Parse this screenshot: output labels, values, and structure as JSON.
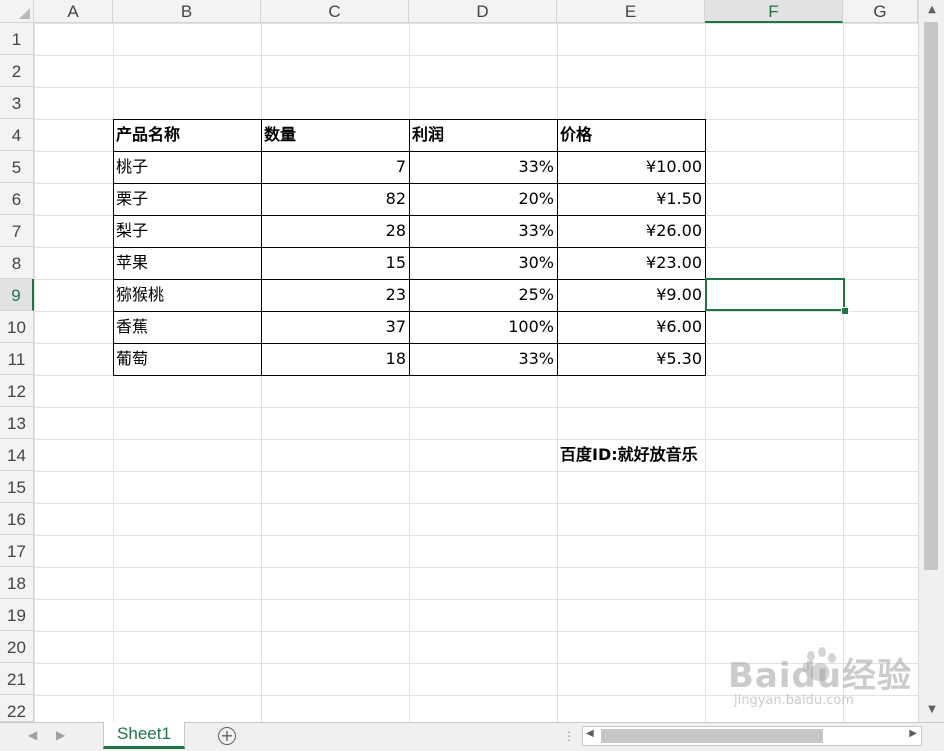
{
  "columns": [
    "A",
    "B",
    "C",
    "D",
    "E",
    "F",
    "G"
  ],
  "active_column": "F",
  "rows": [
    "1",
    "2",
    "3",
    "4",
    "5",
    "6",
    "7",
    "8",
    "9",
    "10",
    "11",
    "12",
    "13",
    "14",
    "15",
    "16",
    "17",
    "18",
    "19",
    "20",
    "21",
    "22"
  ],
  "active_row": "9",
  "table": {
    "headers": [
      "产品名称",
      "数量",
      "利润",
      "价格"
    ],
    "rows": [
      [
        "桃子",
        "7",
        "33%",
        "¥10.00"
      ],
      [
        "栗子",
        "82",
        "20%",
        "¥1.50"
      ],
      [
        "梨子",
        "28",
        "33%",
        "¥26.00"
      ],
      [
        "苹果",
        "15",
        "30%",
        "¥23.00"
      ],
      [
        "猕猴桃",
        "23",
        "25%",
        "¥9.00"
      ],
      [
        "香蕉",
        "37",
        "100%",
        "¥6.00"
      ],
      [
        "葡萄",
        "18",
        "33%",
        "¥5.30"
      ]
    ]
  },
  "note": "百度ID:就好放音乐",
  "sheet_tab": "Sheet1",
  "watermark": {
    "main": "Baidu经验",
    "sub": "jingyan.baidu.com"
  },
  "colors": {
    "accent": "#217346",
    "gridline": "#e1e1e1"
  }
}
